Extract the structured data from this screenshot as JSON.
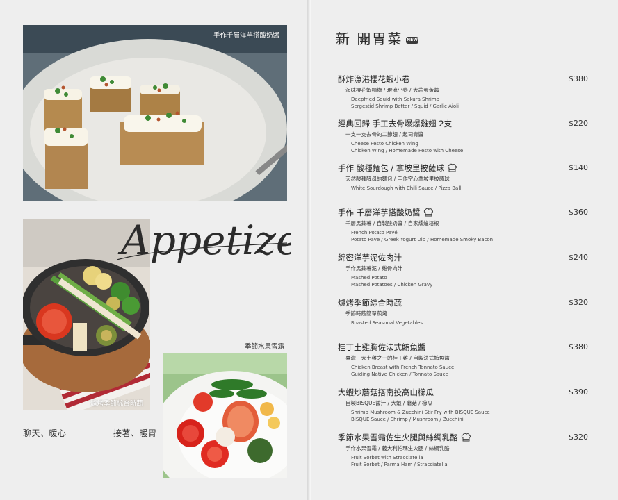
{
  "left_page": {
    "photo_captions": {
      "potato": "手作千層洋芋搭酸奶醬",
      "vegetables": "爐烤季節綜合時蔬",
      "sorbet": "季節水果雪霜"
    },
    "script_title": "Appetizer",
    "slogans": [
      "聊天、暖心",
      "接著、暖胃"
    ]
  },
  "right_page": {
    "title": "新 開胃菜",
    "badge": "NEW",
    "items": [
      {
        "name": "酥炸漁港櫻花蝦小卷",
        "price": "$380",
        "sub": "海味櫻花蝦麵糊 / 現流小卷 / 大蒜蛋黃醬",
        "en": "Deepfried Squid with Sakura Shrimp",
        "en2": "Sergestid Shrimp Batter / Squid / Garlic Aioli"
      },
      {
        "name": "經典回歸 手工去骨爆爆雞翅 2支",
        "price": "$220",
        "sub": "一支一支去骨的二節翅 / 起司青醬",
        "en": "Cheese Pesto Chicken Wing",
        "en2": "Chicken Wing / Homemade Pesto with Cheese"
      },
      {
        "name": "手作 酸種麵包 / 拿坡里披薩球",
        "price": "$140",
        "sub": "天然酸種酵母的麵包 / 手作空心拿坡里披薩球",
        "en": "White Sourdough with Chili Sauce / Pizza Ball",
        "en2": ""
      },
      {
        "name": "手作 千層洋芋搭酸奶醬",
        "price": "$360",
        "sub": "千層馬鈴薯 / 自製酸奶醬 / 自家燻爐培根",
        "en": "French Potato Pavé",
        "en2": "Potato Pave / Greek Yogurt Dip / Homemade Smoky Bacon"
      },
      {
        "name": "綿密洋芋泥佐肉汁",
        "price": "$240",
        "sub": "手作馬鈴薯泥 / 雞骨肉汁",
        "en": "Mashed Potato",
        "en2": "Mashed Potatoes / Chicken Gravy"
      },
      {
        "name": "爐烤季節綜合時蔬",
        "price": "$320",
        "sub": "季節時蔬簡單煎烤",
        "en": "Roasted Seasonal Vegetables",
        "en2": ""
      },
      {
        "name": "桂丁土雞胸佐法式鮪魚醬",
        "price": "$380",
        "sub": "臺灣三大土雞之一的桂丁雞 / 自製法式鮪魚醬",
        "en": "Chicken Breast with French Tonnato Sauce",
        "en2": "Guiding Native Chicken / Tonnato Sauce"
      },
      {
        "name": "大蝦炒蘑菇搭南投高山櫛瓜",
        "price": "$390",
        "sub": "自製BISQUE醬汁 / 大蝦 / 蘑菇 / 櫛瓜",
        "en": "Shrimp Mushroom & Zucchini Stir Fry with BISQUE Sauce",
        "en2": "BISQUE Sauce / Shrimp / Mushroom / Zucchini"
      },
      {
        "name": "季節水果雪霜佐生火腿與絲綢乳酪",
        "price": "$320",
        "sub": "手作水果雪霜 / 義大利帕瑪生火腿 / 絲綢乳酪",
        "en": "Fruit Sorbet with Stracciatella",
        "en2": "Fruit Sorbet /  Parma Ham / Stracciatella"
      }
    ]
  }
}
